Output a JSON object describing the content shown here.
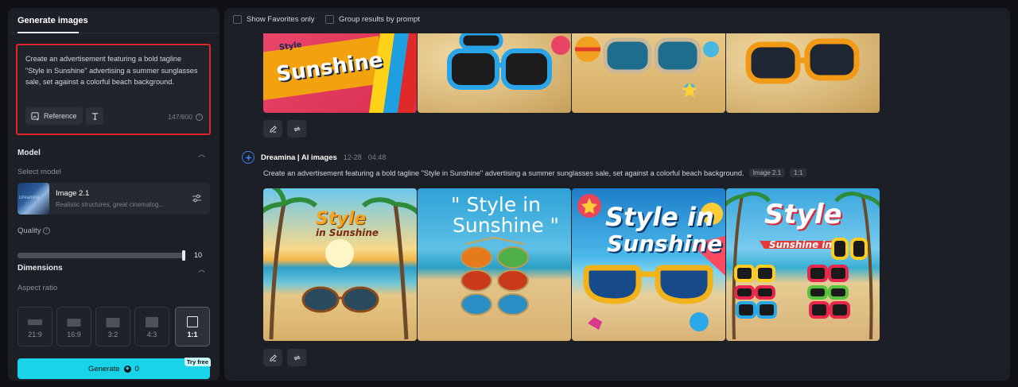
{
  "left_panel": {
    "tab_label": "Generate images",
    "prompt": {
      "text": "Create an advertisement featuring a bold tagline \"Style in Sunshine\" advertising a summer sunglasses sale, set against a colorful beach background.",
      "reference_label": "Reference",
      "char_count": "147/800"
    },
    "model": {
      "section_title": "Model",
      "select_label": "Select model",
      "name": "Image 2.1",
      "description": "Realistic structures, great cinematog...",
      "thumb_text": "Dreamina"
    },
    "quality": {
      "label": "Quality",
      "value": "10",
      "level_fraction": 0.99
    },
    "dimensions": {
      "section_title": "Dimensions",
      "aspect_label": "Aspect ratio",
      "ratios": [
        "21:9",
        "16:9",
        "3:2",
        "4:3",
        "1:1"
      ],
      "selected": "1:1"
    },
    "generate": {
      "label": "Generate",
      "cost": "0",
      "badge": "Try free"
    }
  },
  "right_panel": {
    "filters": {
      "favorites": "Show Favorites only",
      "group": "Group results by prompt"
    },
    "top_images": {
      "img1_tag": "Style",
      "img1_text": "Sunshine"
    },
    "generation": {
      "author": "Dreamina | AI images",
      "date": "12-28",
      "time": "04:48",
      "prompt": "Create an advertisement featuring a bold tagline \"Style in Sunshine\" advertising a summer sunglasses sale, set against a colorful beach background.",
      "tag_model": "Image 2.1",
      "tag_ratio": "1:1",
      "images": [
        {
          "line1": "Style",
          "line2": "in Sunshine"
        },
        {
          "line1": "\" Style in",
          "line2": "Sunshine \""
        },
        {
          "line1": "Style in",
          "line2": "Sunshine"
        },
        {
          "line1": "Style",
          "line2": "Sunshine in"
        }
      ]
    }
  },
  "colors": {
    "accent": "#19d3e8",
    "highlight_border": "#e0262a",
    "panel_bg": "#1c1f25",
    "page_bg": "#0f1115"
  }
}
